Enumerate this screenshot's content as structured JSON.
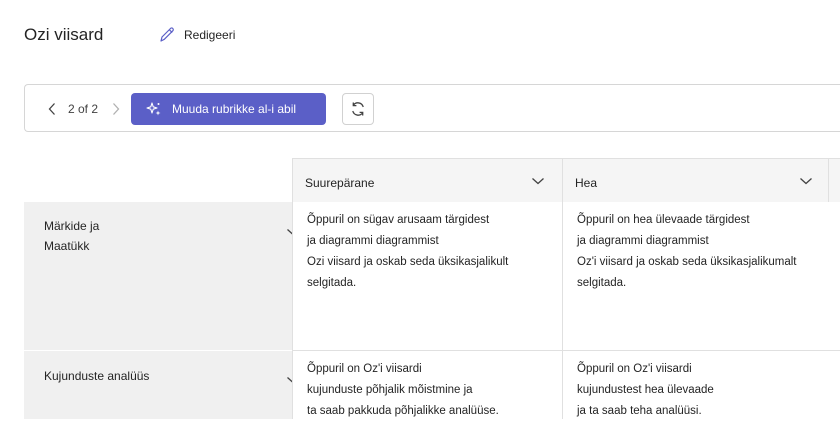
{
  "header": {
    "title": "Ozi viisard",
    "edit_label": "Redigeeri"
  },
  "toolbar": {
    "pager_text": "2 of 2",
    "ai_button_label": "Muuda rubrikke al-i abil"
  },
  "columns": [
    {
      "label": "Suurepärane"
    },
    {
      "label": "Hea"
    }
  ],
  "rows": [
    {
      "label_lines": [
        "Märkide ja",
        "Maatükk"
      ],
      "cells": [
        [
          "Õppuril on sügav arusaam tärgidest",
          "ja diagrammi diagrammist",
          "Ozi viisard ja oskab seda üksikasjalikult",
          "selgitada."
        ],
        [
          "Õppuril on hea ülevaade tärgidest",
          "ja diagrammi diagrammist",
          "Oz'i viisard ja oskab seda üksikasjalikumalt",
          "selgitada."
        ]
      ]
    },
    {
      "label_lines": [
        "Kujunduste analüüs"
      ],
      "cells": [
        [
          "Õppuril on Oz'i viisardi",
          "kujunduste põhjalik mõistmine ja",
          "ta saab pakkuda põhjalikke analüüse."
        ],
        [
          "Õppuril on Oz'i viisardi",
          "kujundustest hea ülevaade",
          "ja ta saab teha analüüsi."
        ]
      ]
    }
  ],
  "icons": {
    "edit": "pencil-icon",
    "prev": "chevron-left-icon",
    "next": "chevron-right-icon",
    "ai": "sparkle-icon",
    "refresh": "refresh-icon",
    "expand": "chevron-down-icon"
  },
  "colors": {
    "accent": "#5b5fc7",
    "row_header_bg": "#f0f0f0",
    "column_header_bg": "#f5f5f5"
  }
}
